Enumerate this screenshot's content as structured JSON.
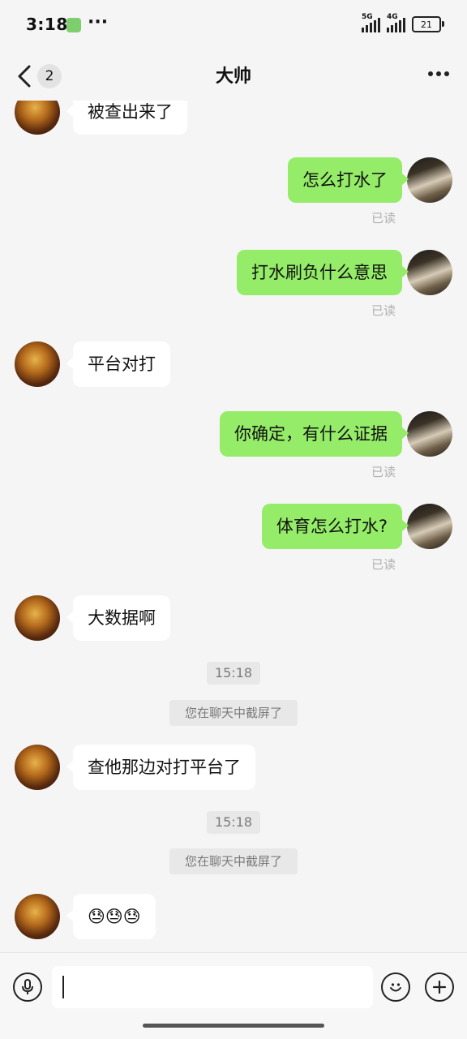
{
  "status": {
    "time": "3:18",
    "network_primary": "5G",
    "network_secondary": "4G",
    "battery": "21"
  },
  "nav": {
    "unread_count": "2",
    "title": "大帅"
  },
  "messages": [
    {
      "side": "left",
      "text": "被查出来了"
    },
    {
      "side": "right",
      "text": "怎么打水了",
      "status": "已读"
    },
    {
      "side": "right",
      "text": "打水刷负什么意思",
      "status": "已读"
    },
    {
      "side": "left",
      "text": "平台对打"
    },
    {
      "side": "right",
      "text": "你确定，有什么证据",
      "status": "已读"
    },
    {
      "side": "right",
      "text": "体育怎么打水?",
      "status": "已读"
    },
    {
      "side": "left",
      "text": "大数据啊"
    },
    {
      "type": "time",
      "text": "15:18"
    },
    {
      "type": "system",
      "text": "您在聊天中截屏了"
    },
    {
      "side": "left",
      "text": "查他那边对打平台了"
    },
    {
      "type": "time",
      "text": "15:18"
    },
    {
      "type": "system",
      "text": "您在聊天中截屏了"
    },
    {
      "side": "left",
      "text": "😓😓😓",
      "emoji_names": [
        "sweat-emoji",
        "sweat-emoji",
        "sweat-emoji"
      ]
    }
  ],
  "input": {
    "value": "",
    "placeholder": ""
  },
  "colors": {
    "sent_bubble": "#95ec69",
    "received_bubble": "#ffffff",
    "background": "#f5f5f5"
  },
  "icons": [
    "back-arrow-icon",
    "more-dots-icon",
    "voice-icon",
    "emoji-icon",
    "plus-icon"
  ]
}
